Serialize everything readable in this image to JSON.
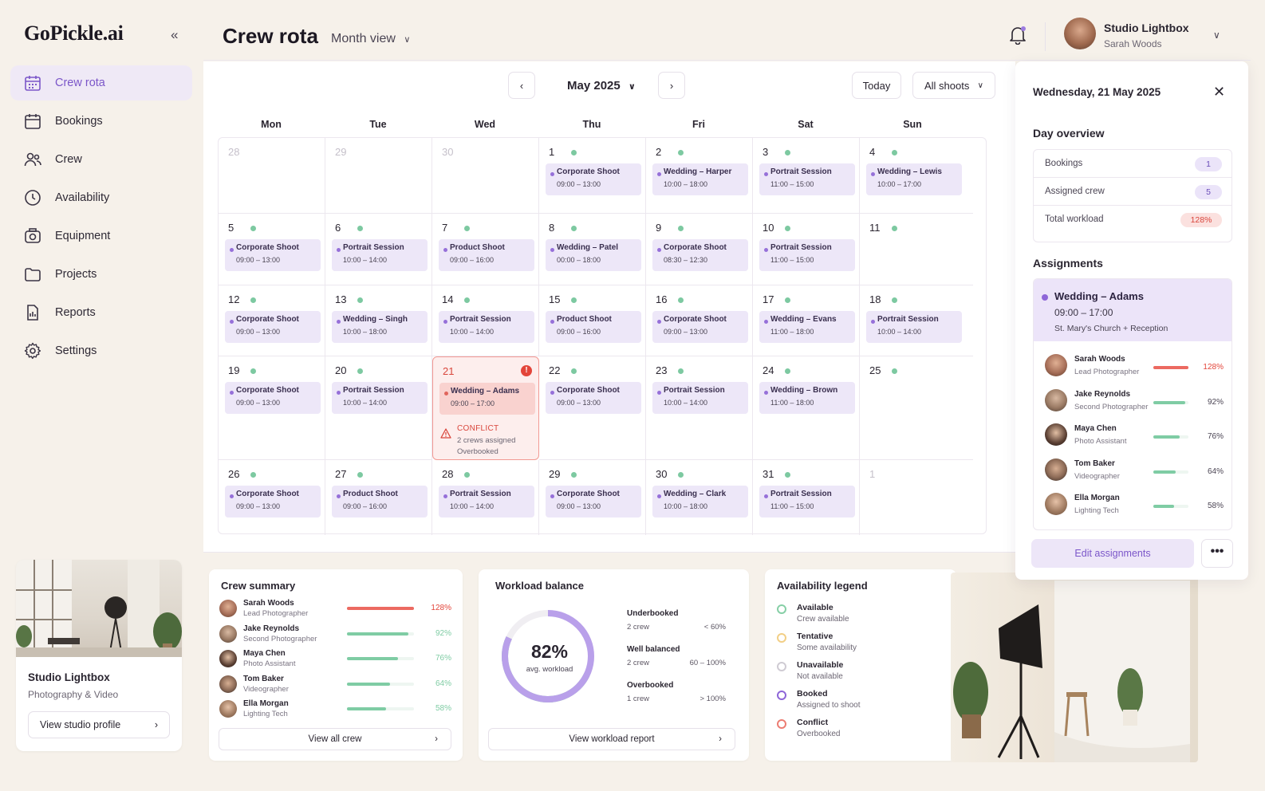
{
  "app": {
    "logo": "GoPickle.ai",
    "collapse_icon": "double-chevron-left-icon"
  },
  "sidebar": {
    "items": [
      {
        "label": "Crew rota",
        "icon": "calendar-grid-icon",
        "active": true
      },
      {
        "label": "Bookings",
        "icon": "calendar-icon",
        "active": false
      },
      {
        "label": "Crew",
        "icon": "users-icon",
        "active": false
      },
      {
        "label": "Availability",
        "icon": "clock-icon",
        "active": false
      },
      {
        "label": "Equipment",
        "icon": "camera-icon",
        "active": false
      },
      {
        "label": "Projects",
        "icon": "folder-icon",
        "active": false
      },
      {
        "label": "Reports",
        "icon": "report-icon",
        "active": false
      },
      {
        "label": "Settings",
        "icon": "gear-icon",
        "active": false
      }
    ],
    "studio": {
      "name": "Studio Lightbox",
      "subtitle": "Photography & Video",
      "button": "View studio profile"
    }
  },
  "header": {
    "title": "Crew rota",
    "view": "Month view",
    "user": {
      "title": "Studio Lightbox",
      "name": "Sarah Woods"
    }
  },
  "calendar": {
    "month": "May 2025",
    "today_label": "Today",
    "filter": "All shoots",
    "weekdays": [
      "Mon",
      "Tue",
      "Wed",
      "Thu",
      "Fri",
      "Sat",
      "Sun"
    ],
    "weeks": [
      [
        {
          "d": "28",
          "dim": true
        },
        {
          "d": "29",
          "dim": true
        },
        {
          "d": "30",
          "dim": true
        },
        {
          "d": "1",
          "e": "Corporate Shoot",
          "t": "09:00 – 13:00"
        },
        {
          "d": "2",
          "e": "Wedding – Harper",
          "t": "10:00 – 18:00"
        },
        {
          "d": "3",
          "e": "Portrait Session",
          "t": "11:00 – 15:00"
        },
        {
          "d": "4",
          "e": "Wedding – Lewis",
          "t": "10:00 – 17:00"
        }
      ],
      [
        {
          "d": "5",
          "e": "Corporate Shoot",
          "t": "09:00 – 13:00"
        },
        {
          "d": "6",
          "e": "Portrait Session",
          "t": "10:00 – 14:00"
        },
        {
          "d": "7",
          "e": "Product Shoot",
          "t": "09:00 – 16:00"
        },
        {
          "d": "8",
          "e": "Wedding – Patel",
          "t": "00:00 – 18:00"
        },
        {
          "d": "9",
          "e": "Corporate Shoot",
          "t": "08:30 – 12:30"
        },
        {
          "d": "10",
          "e": "Portrait Session",
          "t": "11:00 – 15:00"
        },
        {
          "d": "11"
        }
      ],
      [
        {
          "d": "12",
          "e": "Corporate Shoot",
          "t": "09:00 – 13:00"
        },
        {
          "d": "13",
          "e": "Wedding – Singh",
          "t": "10:00 – 18:00"
        },
        {
          "d": "14",
          "e": "Portrait Session",
          "t": "10:00 – 14:00"
        },
        {
          "d": "15",
          "e": "Product Shoot",
          "t": "09:00 – 16:00"
        },
        {
          "d": "16",
          "e": "Corporate Shoot",
          "t": "09:00 – 13:00"
        },
        {
          "d": "17",
          "e": "Wedding – Evans",
          "t": "11:00 – 18:00"
        },
        {
          "d": "18",
          "e": "Portrait Session",
          "t": "10:00 – 14:00"
        }
      ],
      [
        {
          "d": "19",
          "e": "Corporate Shoot",
          "t": "09:00 – 13:00"
        },
        {
          "d": "20",
          "e": "Portrait Session",
          "t": "10:00 – 14:00"
        },
        {
          "d": "21",
          "e": "Wedding – Adams",
          "t": "09:00 – 17:00",
          "conflict": true
        },
        {
          "d": "22",
          "e": "Corporate Shoot",
          "t": "09:00 – 13:00"
        },
        {
          "d": "23",
          "e": "Portrait Session",
          "t": "10:00 – 14:00"
        },
        {
          "d": "24",
          "e": "Wedding – Brown",
          "t": "11:00 – 18:00"
        },
        {
          "d": "25"
        }
      ],
      [
        {
          "d": "26",
          "e": "Corporate Shoot",
          "t": "09:00 – 13:00"
        },
        {
          "d": "27",
          "e": "Product Shoot",
          "t": "09:00 – 16:00"
        },
        {
          "d": "28",
          "e": "Portrait Session",
          "t": "10:00 – 14:00"
        },
        {
          "d": "29",
          "e": "Corporate Shoot",
          "t": "09:00 – 13:00"
        },
        {
          "d": "30",
          "e": "Wedding – Clark",
          "t": "10:00 – 18:00"
        },
        {
          "d": "31",
          "e": "Portrait Session",
          "t": "11:00 – 15:00"
        },
        {
          "d": "1",
          "dim": true,
          "nodot": true
        }
      ]
    ],
    "conflict": {
      "label": "CONFLICT",
      "line1": "2 crews assigned",
      "line2": "Overbooked",
      "badge": "!"
    }
  },
  "day_panel": {
    "date": "Wednesday, 21 May 2025",
    "overview_title": "Day overview",
    "overview": [
      {
        "label": "Bookings",
        "value": "1"
      },
      {
        "label": "Assigned crew",
        "value": "5"
      },
      {
        "label": "Total workload",
        "value": "128%"
      }
    ],
    "assignments_title": "Assignments",
    "assignment": {
      "title": "Wedding – Adams",
      "time": "09:00 – 17:00",
      "location": "St. Mary's Church + Reception"
    },
    "crew": [
      {
        "name": "Sarah Woods",
        "role": "Lead Photographer",
        "pct": "128%",
        "value": 1.28
      },
      {
        "name": "Jake Reynolds",
        "role": "Second Photographer",
        "pct": "92%",
        "value": 0.92
      },
      {
        "name": "Maya Chen",
        "role": "Photo Assistant",
        "pct": "76%",
        "value": 0.76
      },
      {
        "name": "Tom Baker",
        "role": "Videographer",
        "pct": "64%",
        "value": 0.64
      },
      {
        "name": "Ella Morgan",
        "role": "Lighting Tech",
        "pct": "58%",
        "value": 0.58
      }
    ],
    "edit_button": "Edit assignments",
    "more_button": "•••"
  },
  "crew_summary": {
    "title": "Crew summary",
    "button": "View all crew"
  },
  "workload": {
    "title": "Workload balance",
    "value": "82%",
    "sub": "avg. workload",
    "fraction": 0.82,
    "rows": [
      {
        "name": "Underbooked",
        "crew": "2 crew",
        "range": "< 60%"
      },
      {
        "name": "Well balanced",
        "crew": "2 crew",
        "range": "60 – 100%"
      },
      {
        "name": "Overbooked",
        "crew": "1 crew",
        "range": "> 100%"
      }
    ],
    "button": "View workload report"
  },
  "legend": {
    "title": "Availability legend",
    "items": [
      {
        "name": "Available",
        "desc": "Crew available",
        "color": "#86cfa6"
      },
      {
        "name": "Tentative",
        "desc": "Some availability",
        "color": "#f2cf86"
      },
      {
        "name": "Unavailable",
        "desc": "Not available",
        "color": "#cfcbd3"
      },
      {
        "name": "Booked",
        "desc": "Assigned to shoot",
        "color": "#8e66d8"
      },
      {
        "name": "Conflict",
        "desc": "Overbooked",
        "color": "#ec7d73"
      }
    ]
  },
  "colors": {
    "accent": "#7b56c9",
    "event_bg": "#ede7f8",
    "green": "#7dc9a1",
    "red": "#e3453a"
  }
}
